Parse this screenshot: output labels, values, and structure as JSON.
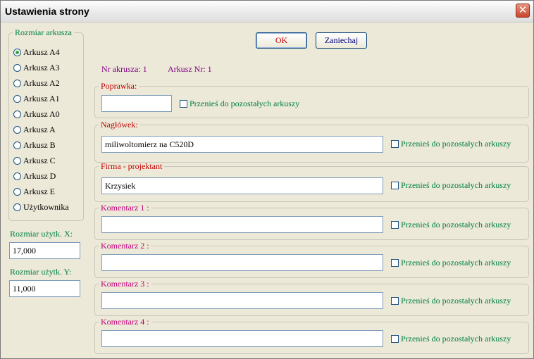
{
  "window": {
    "title": "Ustawienia strony"
  },
  "sheet_size": {
    "legend": "Rozmiar arkusza",
    "options": [
      "Arkusz A4",
      "Arkusz A3",
      "Arkusz A2",
      "Arkusz A1",
      "Arkusz A0",
      "Arkusz A",
      "Arkusz B",
      "Arkusz C",
      "Arkusz D",
      "Arkusz E",
      "Użytkownika"
    ],
    "selected": "Arkusz A4"
  },
  "user_size": {
    "x_label": "Rozmiar użytk. X:",
    "x_value": "17,000",
    "y_label": "Rozmiar użytk. Y:",
    "y_value": "11,000"
  },
  "buttons": {
    "ok": "OK",
    "cancel": "Zaniechaj"
  },
  "sheet_info": {
    "nr_label": "Nr akrusza: 1",
    "arkusz_label": "Arkusz Nr: 1"
  },
  "copy_label": "Przenieś do pozostałych arkuszy",
  "fields": {
    "poprawka": {
      "label": "Poprawka:",
      "value": ""
    },
    "naglowek": {
      "label": "Nagłówek:",
      "value": "miliwoltomierz na C520D"
    },
    "firma": {
      "label": "Firma - projektant",
      "value": "Krzysiek"
    },
    "komentarz1": {
      "label": "Komentarz 1 :",
      "value": ""
    },
    "komentarz2": {
      "label": "Komentarz 2 :",
      "value": ""
    },
    "komentarz3": {
      "label": "Komentarz 3 :",
      "value": ""
    },
    "komentarz4": {
      "label": "Komentarz 4 :",
      "value": ""
    }
  },
  "colors": {
    "green_label": "#008040",
    "red_label": "#c00000",
    "purple_label": "#800080",
    "magenta_label": "#c0007a"
  }
}
